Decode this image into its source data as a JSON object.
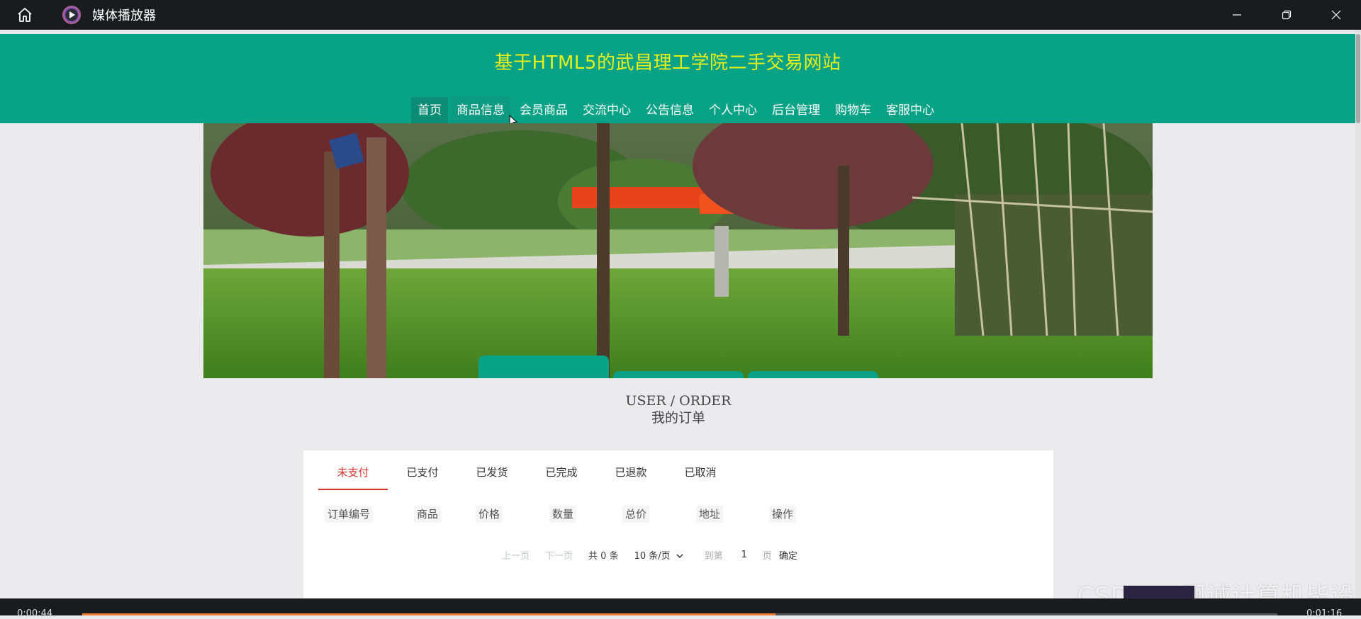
{
  "player": {
    "title": "媒体播放器",
    "current_time": "0:00:44",
    "total_time": "0:01:16",
    "progress": 0.58
  },
  "site": {
    "title": "基于HTML5的武昌理工学院二手交易网站",
    "nav": [
      {
        "label": "首页"
      },
      {
        "label": "商品信息"
      },
      {
        "label": "会员商品"
      },
      {
        "label": "交流中心"
      },
      {
        "label": "公告信息"
      },
      {
        "label": "个人中心"
      },
      {
        "label": "后台管理"
      },
      {
        "label": "购物车"
      },
      {
        "label": "客服中心"
      }
    ]
  },
  "section": {
    "title_en": "USER / ORDER",
    "title_cn": "我的订单"
  },
  "orders": {
    "tabs": [
      {
        "label": "未支付"
      },
      {
        "label": "已支付"
      },
      {
        "label": "已发货"
      },
      {
        "label": "已完成"
      },
      {
        "label": "已退款"
      },
      {
        "label": "已取消"
      }
    ],
    "columns": [
      "订单编号",
      "商品",
      "价格",
      "数量",
      "总价",
      "地址",
      "操作"
    ],
    "pager": {
      "prev": "上一页",
      "next": "下一页",
      "total": "共 0 条",
      "page_size": "10 条/页",
      "goto": "到第",
      "page": "1",
      "page_unit": "页",
      "confirm": "确定"
    }
  },
  "watermark": "CSDN @啊诚计算机毕设",
  "colors": {
    "header": "#08a287",
    "title": "#e8ef1a",
    "active_tab": "#d9322e"
  }
}
